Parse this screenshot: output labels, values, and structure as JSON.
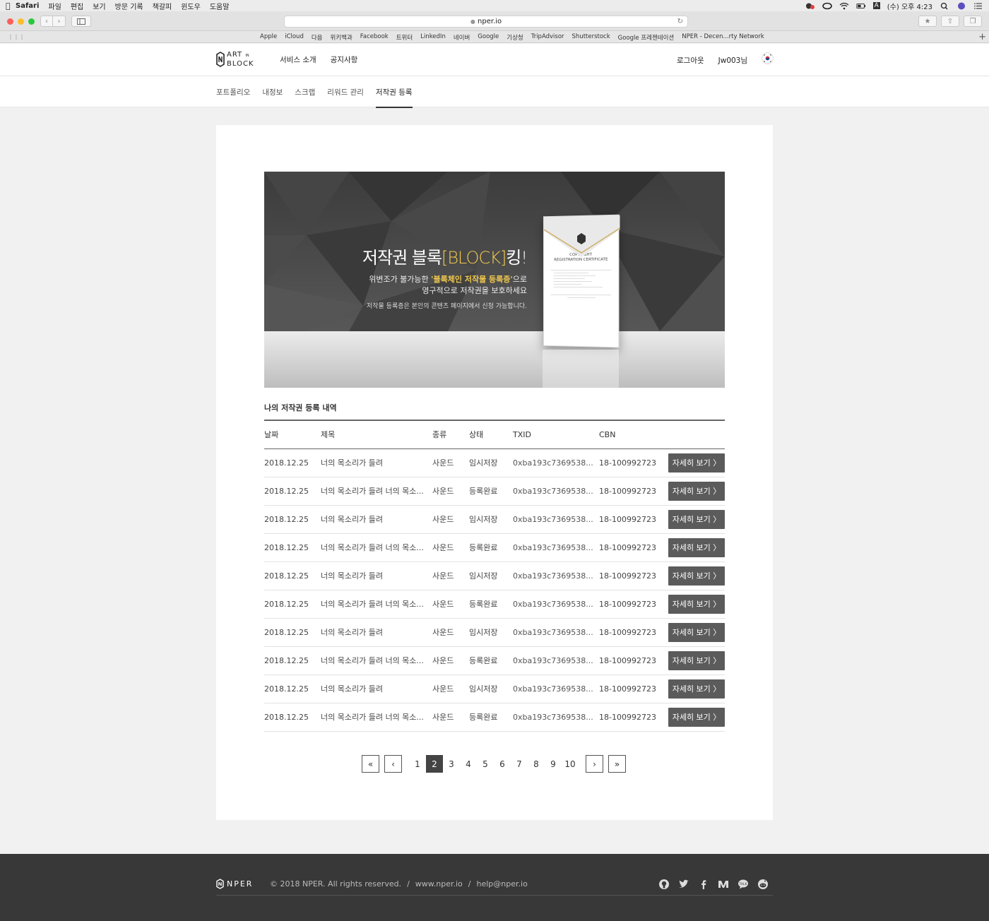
{
  "menubar": {
    "app": "Safari",
    "items": [
      "파일",
      "편집",
      "보기",
      "방문 기록",
      "책갈피",
      "윈도우",
      "도움말"
    ],
    "clock": "(수) 오후 4:23",
    "input_indicator": "A"
  },
  "browser": {
    "url": "nper.io",
    "bookmarks": [
      "Apple",
      "iCloud",
      "다음",
      "위키백과",
      "Facebook",
      "트위터",
      "LinkedIn",
      "네이버",
      "Google",
      "기상청",
      "TripAdvisor",
      "Shutterstock",
      "Google 프레젠테이션",
      "NPER - Decen...rty Network"
    ]
  },
  "header": {
    "logo_top": "ART",
    "logo_in": "IN",
    "logo_bottom": "BLOCK",
    "nav": [
      "서비스 소개",
      "공지사항"
    ],
    "logout": "로그아웃",
    "username": "Jw003님"
  },
  "subnav": {
    "tabs": [
      "포트폴리오",
      "내정보",
      "스크랩",
      "리워드 관리",
      "저작권 등록"
    ],
    "active": "저작권 등록"
  },
  "banner": {
    "title_pre": "저작권 블록",
    "title_accent": "[BLOCK]",
    "title_post": "킹!",
    "sub_pre": "위변조가 불가능한 ",
    "sub_accent": "'블록체인 저작물 등록증'",
    "sub_post": "으로",
    "sub_line2": "영구적으로 저작권을 보호하세요",
    "note": "저작물 등록증은 본인의 콘텐츠 페이지에서 신청 가능합니다.",
    "cert_title": "COPYRIGHT",
    "cert_subtitle": "REGISTRATION CERTIFICATE"
  },
  "registrations": {
    "section_title": "나의 저작권 등록 내역",
    "columns": [
      "날짜",
      "제목",
      "종류",
      "상태",
      "TXID",
      "CBN",
      ""
    ],
    "rows": [
      {
        "date": "2018.12.25",
        "title": "너의 목소리가 들려",
        "kind": "사운드",
        "status": "임시저장",
        "txid": "0xba193c7369538...",
        "cbn": "18-100992723",
        "action": "자세히 보기 〉"
      },
      {
        "date": "2018.12.25",
        "title": "너의 목소리가 들려 너의 목소...",
        "kind": "사운드",
        "status": "등록완료",
        "txid": "0xba193c7369538...",
        "cbn": "18-100992723",
        "action": "자세히 보기 〉"
      },
      {
        "date": "2018.12.25",
        "title": "너의 목소리가 들려",
        "kind": "사운드",
        "status": "임시저장",
        "txid": "0xba193c7369538...",
        "cbn": "18-100992723",
        "action": "자세히 보기 〉"
      },
      {
        "date": "2018.12.25",
        "title": "너의 목소리가 들려 너의 목소...",
        "kind": "사운드",
        "status": "등록완료",
        "txid": "0xba193c7369538...",
        "cbn": "18-100992723",
        "action": "자세히 보기 〉"
      },
      {
        "date": "2018.12.25",
        "title": "너의 목소리가 들려",
        "kind": "사운드",
        "status": "임시저장",
        "txid": "0xba193c7369538...",
        "cbn": "18-100992723",
        "action": "자세히 보기 〉"
      },
      {
        "date": "2018.12.25",
        "title": "너의 목소리가 들려 너의 목소...",
        "kind": "사운드",
        "status": "등록완료",
        "txid": "0xba193c7369538...",
        "cbn": "18-100992723",
        "action": "자세히 보기 〉"
      },
      {
        "date": "2018.12.25",
        "title": "너의 목소리가 들려",
        "kind": "사운드",
        "status": "임시저장",
        "txid": "0xba193c7369538...",
        "cbn": "18-100992723",
        "action": "자세히 보기 〉"
      },
      {
        "date": "2018.12.25",
        "title": "너의 목소리가 들려 너의 목소...",
        "kind": "사운드",
        "status": "등록완료",
        "txid": "0xba193c7369538...",
        "cbn": "18-100992723",
        "action": "자세히 보기 〉"
      },
      {
        "date": "2018.12.25",
        "title": "너의 목소리가 들려",
        "kind": "사운드",
        "status": "임시저장",
        "txid": "0xba193c7369538...",
        "cbn": "18-100992723",
        "action": "자세히 보기 〉"
      },
      {
        "date": "2018.12.25",
        "title": "너의 목소리가 들려 너의 목소...",
        "kind": "사운드",
        "status": "등록완료",
        "txid": "0xba193c7369538...",
        "cbn": "18-100992723",
        "action": "자세히 보기 〉"
      }
    ]
  },
  "pagination": {
    "first": "«",
    "prev": "‹",
    "pages": [
      "1",
      "2",
      "3",
      "4",
      "5",
      "6",
      "7",
      "8",
      "9",
      "10"
    ],
    "current": "2",
    "next": "›",
    "last": "»"
  },
  "footer": {
    "brand": "NPER",
    "copyright": "© 2018 NPER. All rights reserved.",
    "sep": "/",
    "website": "www.nper.io",
    "email": "help@nper.io",
    "social": [
      "github-icon",
      "twitter-icon",
      "facebook-icon",
      "medium-icon",
      "kakaotalk-icon",
      "reddit-icon"
    ]
  },
  "colors": {
    "accent_gold": "#f2c94c",
    "button_dark": "#5b5b5b",
    "footer_bg": "#383838"
  }
}
